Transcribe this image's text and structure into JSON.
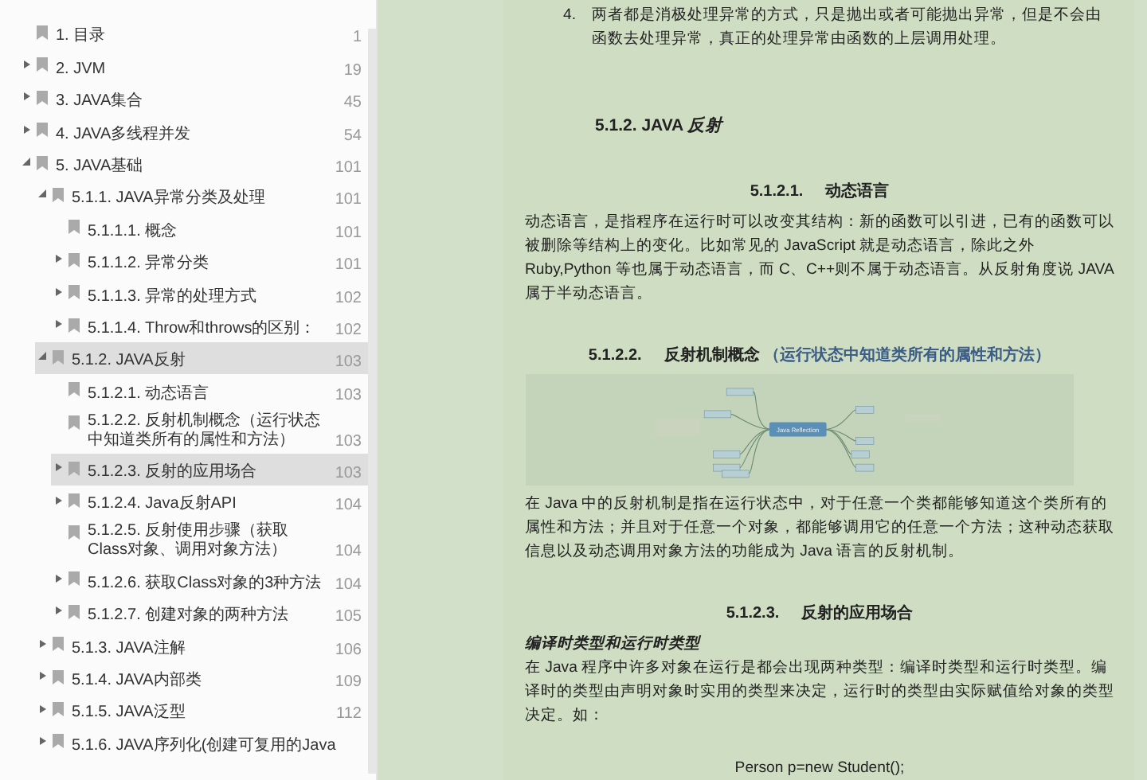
{
  "bookmarks": [
    {
      "title": "1. 目录",
      "page": "1",
      "selected": false
    },
    {
      "title": "2. JVM",
      "page": "19",
      "selected": false,
      "expanded": false
    },
    {
      "title": "3. JAVA集合",
      "page": "45",
      "selected": false,
      "expanded": false
    },
    {
      "title": "4. JAVA多线程并发",
      "page": "54",
      "selected": false,
      "expanded": false
    },
    {
      "title": "5. JAVA基础",
      "page": "101",
      "selected": false,
      "expanded": true,
      "children": [
        {
          "title": "5.1.1. JAVA异常分类及处理",
          "page": "101",
          "selected": false,
          "expanded": true,
          "children": [
            {
              "title": "5.1.1.1. 概念",
              "page": "101",
              "selected": false
            },
            {
              "title": "5.1.1.2. 异常分类",
              "page": "101",
              "selected": false,
              "expanded": false
            },
            {
              "title": "5.1.1.3. 异常的处理方式",
              "page": "102",
              "selected": false,
              "expanded": false
            },
            {
              "title": "5.1.1.4. Throw和throws的区别：",
              "page": "102",
              "selected": false,
              "expanded": false
            }
          ]
        },
        {
          "title": "5.1.2. JAVA反射",
          "page": "103",
          "selected": true,
          "expanded": true,
          "children": [
            {
              "title": "5.1.2.1. 动态语言",
              "page": "103",
              "selected": false
            },
            {
              "title": "5.1.2.2. 反射机制概念（运行状态中知道类所有的属性和方法）",
              "page": "103",
              "selected": false
            },
            {
              "title": "5.1.2.3. 反射的应用场合",
              "page": "103",
              "selected": true,
              "expanded": false
            },
            {
              "title": "5.1.2.4. Java反射API",
              "page": "104",
              "selected": false,
              "expanded": false
            },
            {
              "title": "5.1.2.5. 反射使用步骤（获取Class对象、调用对象方法）",
              "page": "104",
              "selected": false
            },
            {
              "title": "5.1.2.6. 获取Class对象的3种方法",
              "page": "104",
              "selected": false,
              "expanded": false
            },
            {
              "title": "5.1.2.7. 创建对象的两种方法",
              "page": "105",
              "selected": false,
              "expanded": false
            }
          ]
        },
        {
          "title": "5.1.3. JAVA注解",
          "page": "106",
          "selected": false,
          "expanded": false
        },
        {
          "title": "5.1.4. JAVA内部类",
          "page": "109",
          "selected": false,
          "expanded": false
        },
        {
          "title": "5.1.5. JAVA泛型",
          "page": "112",
          "selected": false,
          "expanded": false
        },
        {
          "title": "5.1.6. JAVA序列化(创建可复用的Java",
          "selected": false,
          "expanded": false
        }
      ]
    }
  ],
  "document": [
    {
      "kind": "list",
      "marker": "4.",
      "text": "两者都是消极处理异常的方式，只是抛出或者可能抛出异常，但是不会由函数去处理异常，真正的处理异常由函数的上层调用处理。"
    },
    {
      "kind": "h2",
      "text": "5.1.2. JAVA *反射*"
    },
    {
      "kind": "h3",
      "number": "5.1.2.1.",
      "text": "动态语言"
    },
    {
      "kind": "p",
      "text": "动态语言，是指程序在运行时可以改变其结构：新的函数可以引进，已有的函数可以被删除等结构上的变化。比如常见的 JavaScript 就是动态语言，除此之外 Ruby,Python 等也属于动态语言，而 C、C++则不属于动态语言。从反射角度说 JAVA 属于半动态语言。"
    },
    {
      "kind": "h3",
      "number": "5.1.2.2.",
      "text": "反射机制概念",
      "note": "（运行状态中知道类所有的属性和方法）"
    },
    {
      "kind": "mindmap",
      "center": "Java Reflection"
    },
    {
      "kind": "p",
      "text": "在 Java 中的反射机制是指在运行状态中，对于任意一个类都能够知道这个类所有的属性和方法；并且对于任意一个对象，都能够调用它的任意一个方法；这种动态获取信息以及动态调用对象方法的功能成为 Java 语言的反射机制。"
    },
    {
      "kind": "h3",
      "number": "5.1.2.3.",
      "text": "反射的应用场合"
    },
    {
      "kind": "h4",
      "text": "编译时类型和运行时类型"
    },
    {
      "kind": "p",
      "text": "在 Java 程序中许多对象在运行是都会出现两种类型：编译时类型和运行时类型。编译时的类型由声明对象时实用的类型来决定，运行时的类型由实际赋值给对象的类型决定。如："
    },
    {
      "kind": "code",
      "text": "Person p=new Student();"
    }
  ]
}
